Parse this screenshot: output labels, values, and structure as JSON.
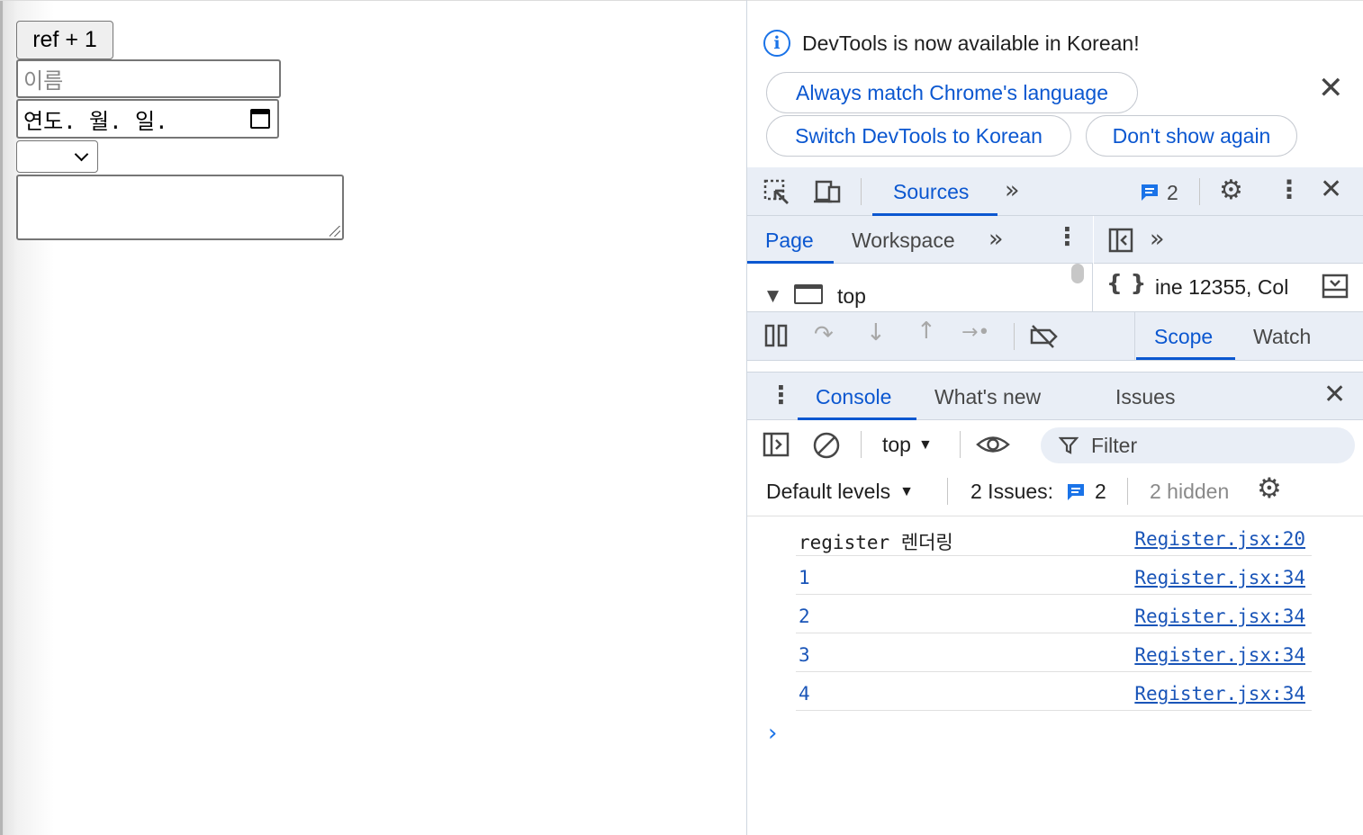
{
  "page": {
    "ref_button": "ref + 1",
    "name_placeholder": "이름",
    "date_placeholder": "연도. 월. 일.",
    "select_value": "",
    "textarea_value": ""
  },
  "devtools": {
    "infobar": {
      "message": "DevTools is now available in Korean!",
      "btn_match": "Always match Chrome's language",
      "btn_switch": "Switch DevTools to Korean",
      "btn_dont_show": "Don't show again"
    },
    "main_tabs": {
      "active": "Sources",
      "issues_count": "2"
    },
    "navigator": {
      "tab_page": "Page",
      "tab_workspace": "Workspace",
      "tree_top": "top"
    },
    "editor": {
      "status": "ine 12355, Col"
    },
    "sidebar_tabs": {
      "scope": "Scope",
      "watch": "Watch"
    },
    "drawer_tabs": {
      "console": "Console",
      "whats_new": "What's new",
      "issues": "Issues"
    },
    "console_toolbar": {
      "context": "top",
      "filter_placeholder": "Filter",
      "levels": "Default levels",
      "issues_label": "2 Issues:",
      "issues_count": "2",
      "hidden": "2 hidden"
    },
    "console_rows": [
      {
        "message": "register 렌더링",
        "source": "Register.jsx:20"
      },
      {
        "message": "1",
        "source": "Register.jsx:34"
      },
      {
        "message": "2",
        "source": "Register.jsx:34"
      },
      {
        "message": "3",
        "source": "Register.jsx:34"
      },
      {
        "message": "4",
        "source": "Register.jsx:34"
      }
    ],
    "prompt": "›"
  },
  "colors": {
    "accent": "#0b57d0",
    "toolbar_bg": "#e9eef6",
    "link": "#1a55b8"
  }
}
